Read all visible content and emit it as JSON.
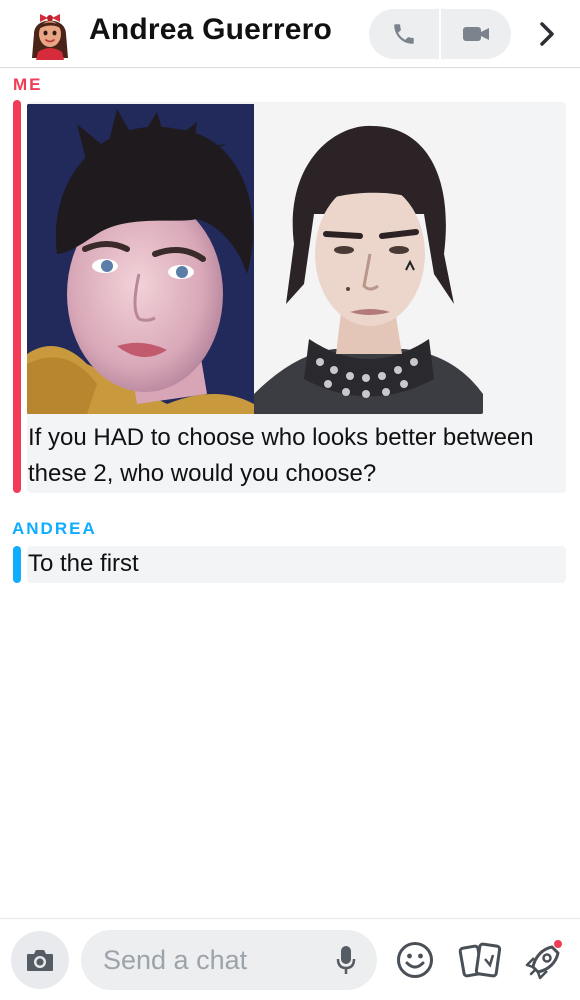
{
  "header": {
    "title": "Andrea Guerrero",
    "avatar_icon": "bitmoji-avatar",
    "phone_icon": "phone-icon",
    "video_icon": "video-camera-icon",
    "chevron_icon": "chevron-right-icon"
  },
  "conversation": {
    "messages": [
      {
        "sender": "ME",
        "sender_color": "#f23c57",
        "media": [
          "photo-1",
          "photo-2"
        ],
        "text": "If you HAD to choose who looks better between these 2, who would you choose?"
      },
      {
        "sender": "ANDREA",
        "sender_color": "#0eadff",
        "text": "To the first"
      }
    ]
  },
  "composer": {
    "placeholder": "Send a chat",
    "value": "",
    "camera_icon": "camera-icon",
    "mic_icon": "microphone-icon",
    "smiley_icon": "smiley-icon",
    "cards_icon": "cards-icon",
    "rocket_icon": "rocket-icon"
  },
  "colors": {
    "me_accent": "#f23c57",
    "them_accent": "#0eadff",
    "bubble_bg": "#f3f4f6",
    "pill_bg": "#eceef0"
  }
}
